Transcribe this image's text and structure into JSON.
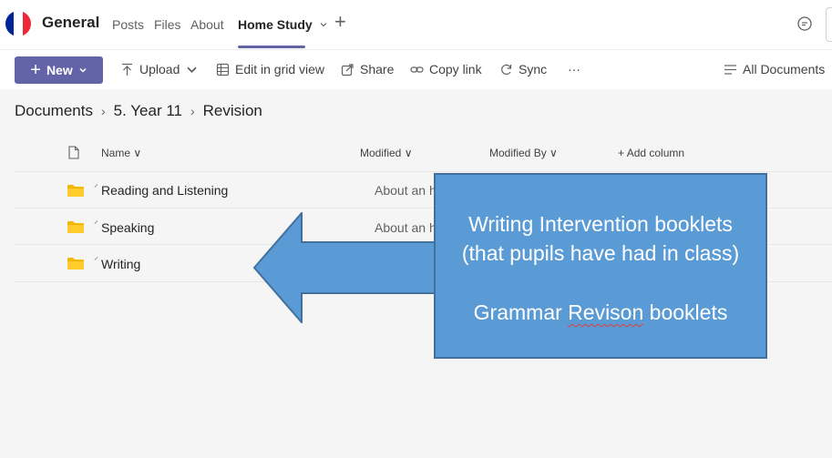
{
  "header": {
    "team_name": "General",
    "tabs": [
      {
        "label": "Posts"
      },
      {
        "label": "Files"
      },
      {
        "label": "About"
      },
      {
        "label": "Home Study"
      }
    ],
    "add_tab_icon": "plus-icon",
    "chat_icon": "chat-icon",
    "flag_colors": [
      "#002395",
      "#ffffff",
      "#ed2939"
    ]
  },
  "toolbar": {
    "new_label": "New",
    "upload_label": "Upload",
    "grid_label": "Edit in grid view",
    "share_label": "Share",
    "copy_link_label": "Copy link",
    "sync_label": "Sync",
    "more_label": "···",
    "view_label": "All Documents",
    "accent": "#6264a7"
  },
  "breadcrumb": {
    "items": [
      "Documents",
      "5. Year 11",
      "Revision"
    ]
  },
  "table": {
    "columns": {
      "name": "Name",
      "modified": "Modified",
      "modified_by": "Modified By",
      "add_column": "Add column"
    },
    "rows": [
      {
        "name": "Reading and Listening",
        "modified": "About an hou"
      },
      {
        "name": "Speaking",
        "modified": "About an hou"
      },
      {
        "name": "Writing",
        "modified": ""
      }
    ]
  },
  "callout": {
    "line1": "Writing Intervention booklets",
    "line2": "(that pupils have had in class)",
    "line3_word1": "Grammar",
    "line3_word2": "Revison",
    "line3_word3": "booklets",
    "fill": "#5b9bd5",
    "stroke": "#41719c"
  }
}
